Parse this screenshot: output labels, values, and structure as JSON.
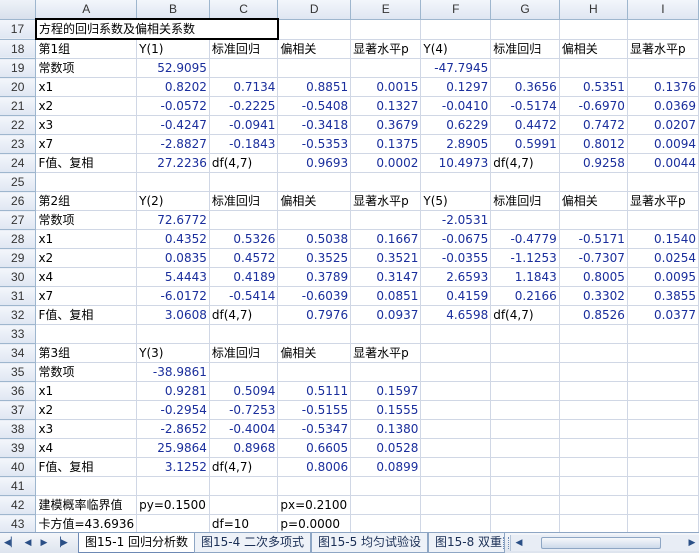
{
  "columns": [
    "A",
    "B",
    "C",
    "D",
    "E",
    "F",
    "G",
    "H",
    "I"
  ],
  "rows": [
    {
      "n": "17",
      "cells": [
        "方程的回归系数及偏相关系数",
        "",
        "",
        "",
        "",
        "",
        "",
        "",
        ""
      ],
      "title": true
    },
    {
      "n": "18",
      "cells": [
        "第1组",
        "Y(1)",
        "标准回归",
        "偏相关",
        "显著水平p",
        "Y(4)",
        "标准回归",
        "偏相关",
        "显著水平p"
      ]
    },
    {
      "n": "19",
      "cells": [
        "常数项",
        "52.9095",
        "",
        "",
        "",
        "-47.7945",
        "",
        "",
        ""
      ]
    },
    {
      "n": "20",
      "cells": [
        "x1",
        "0.8202",
        "0.7134",
        "0.8851",
        "0.0015",
        "0.1297",
        "0.3656",
        "0.5351",
        "0.1376"
      ]
    },
    {
      "n": "21",
      "cells": [
        "x2",
        "-0.0572",
        "-0.2225",
        "-0.5408",
        "0.1327",
        "-0.0410",
        "-0.5174",
        "-0.6970",
        "0.0369"
      ]
    },
    {
      "n": "22",
      "cells": [
        "x3",
        "-0.4247",
        "-0.0941",
        "-0.3418",
        "0.3679",
        "0.6229",
        "0.4472",
        "0.7472",
        "0.0207"
      ]
    },
    {
      "n": "23",
      "cells": [
        "x7",
        "-2.8827",
        "-0.1843",
        "-0.5353",
        "0.1375",
        "2.8905",
        "0.5991",
        "0.8012",
        "0.0094"
      ]
    },
    {
      "n": "24",
      "cells": [
        "F值、复相",
        "27.2236",
        "df(4,7)",
        "0.9693",
        "0.0002",
        "10.4973",
        "df(4,7)",
        "0.9258",
        "0.0044"
      ]
    },
    {
      "n": "25",
      "cells": [
        "",
        "",
        "",
        "",
        "",
        "",
        "",
        "",
        ""
      ]
    },
    {
      "n": "26",
      "cells": [
        "第2组",
        "Y(2)",
        "标准回归",
        "偏相关",
        "显著水平p",
        "Y(5)",
        "标准回归",
        "偏相关",
        "显著水平p"
      ]
    },
    {
      "n": "27",
      "cells": [
        "常数项",
        "72.6772",
        "",
        "",
        "",
        "-2.0531",
        "",
        "",
        ""
      ]
    },
    {
      "n": "28",
      "cells": [
        "x1",
        "0.4352",
        "0.5326",
        "0.5038",
        "0.1667",
        "-0.0675",
        "-0.4779",
        "-0.5171",
        "0.1540"
      ]
    },
    {
      "n": "29",
      "cells": [
        "x2",
        "0.0835",
        "0.4572",
        "0.3525",
        "0.3521",
        "-0.0355",
        "-1.1253",
        "-0.7307",
        "0.0254"
      ]
    },
    {
      "n": "30",
      "cells": [
        "x4",
        "5.4443",
        "0.4189",
        "0.3789",
        "0.3147",
        "2.6593",
        "1.1843",
        "0.8005",
        "0.0095"
      ]
    },
    {
      "n": "31",
      "cells": [
        "x7",
        "-6.0172",
        "-0.5414",
        "-0.6039",
        "0.0851",
        "0.4159",
        "0.2166",
        "0.3302",
        "0.3855"
      ]
    },
    {
      "n": "32",
      "cells": [
        "F值、复相",
        "3.0608",
        "df(4,7)",
        "0.7976",
        "0.0937",
        "4.6598",
        "df(4,7)",
        "0.8526",
        "0.0377"
      ]
    },
    {
      "n": "33",
      "cells": [
        "",
        "",
        "",
        "",
        "",
        "",
        "",
        "",
        ""
      ]
    },
    {
      "n": "34",
      "cells": [
        "第3组",
        "Y(3)",
        "标准回归",
        "偏相关",
        "显著水平p",
        "",
        "",
        "",
        ""
      ]
    },
    {
      "n": "35",
      "cells": [
        "常数项",
        "-38.9861",
        "",
        "",
        "",
        "",
        "",
        "",
        ""
      ]
    },
    {
      "n": "36",
      "cells": [
        "x1",
        "0.9281",
        "0.5094",
        "0.5111",
        "0.1597",
        "",
        "",
        "",
        ""
      ]
    },
    {
      "n": "37",
      "cells": [
        "x2",
        "-0.2954",
        "-0.7253",
        "-0.5155",
        "0.1555",
        "",
        "",
        "",
        ""
      ]
    },
    {
      "n": "38",
      "cells": [
        "x3",
        "-2.8652",
        "-0.4004",
        "-0.5347",
        "0.1380",
        "",
        "",
        "",
        ""
      ]
    },
    {
      "n": "39",
      "cells": [
        "x4",
        "25.9864",
        "0.8968",
        "0.6605",
        "0.0528",
        "",
        "",
        "",
        ""
      ]
    },
    {
      "n": "40",
      "cells": [
        "F值、复相",
        "3.1252",
        "df(4,7)",
        "0.8006",
        "0.0899",
        "",
        "",
        "",
        ""
      ]
    },
    {
      "n": "41",
      "cells": [
        "",
        "",
        "",
        "",
        "",
        "",
        "",
        "",
        ""
      ]
    },
    {
      "n": "42",
      "cells": [
        "建模概率临界值",
        "py=0.1500",
        "",
        "px=0.2100",
        "",
        "",
        "",
        "",
        ""
      ]
    },
    {
      "n": "43",
      "cells": [
        "卡方值=43.6936",
        "",
        "df=10",
        "p=0.0000",
        "",
        "",
        "",
        "",
        ""
      ]
    }
  ],
  "tabs": [
    "图15-1 回归分析数",
    "图15-4 二次多项式",
    "图15-5 均匀试验设",
    "图15-8 双重"
  ],
  "nav_icons": [
    "first-sheet-icon",
    "prev-sheet-icon",
    "next-sheet-icon",
    "last-sheet-icon"
  ]
}
